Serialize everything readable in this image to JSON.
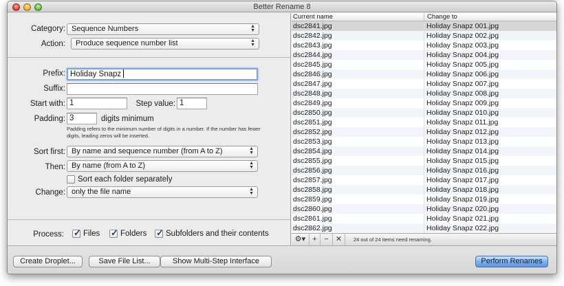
{
  "window": {
    "title": "Better Rename 8"
  },
  "form": {
    "category_label": "Category:",
    "category_value": "Sequence Numbers",
    "action_label": "Action:",
    "action_value": "Produce sequence number list",
    "prefix_label": "Prefix:",
    "prefix_value": "Holiday Snapz",
    "suffix_label": "Suffix:",
    "suffix_value": "",
    "start_label": "Start with:",
    "start_value": "1",
    "step_label": "Step value:",
    "step_value": "1",
    "padding_label": "Padding:",
    "padding_value": "3",
    "padding_suffix": "digits minimum",
    "padding_note": "Padding refers to the minimum number of digits in a number. If the number has fewer digits, leading zeros will be inserted.",
    "sort_first_label": "Sort first:",
    "sort_first_value": "By name and sequence number (from A to Z)",
    "then_label": "Then:",
    "then_value": "By name (from A to Z)",
    "sort_folder_label": "Sort each folder separately",
    "sort_folder_checked": false,
    "change_label": "Change:",
    "change_value": "only the file name",
    "process_label": "Process:",
    "process_files_label": "Files",
    "process_files_checked": true,
    "process_folders_label": "Folders",
    "process_folders_checked": true,
    "process_subfolders_label": "Subfolders and their contents",
    "process_subfolders_checked": true
  },
  "table": {
    "col_current": "Current name",
    "col_change": "Change to",
    "rows": [
      {
        "current": "dsc2841.jpg",
        "change": "Holiday Snapz 001.jpg"
      },
      {
        "current": "dsc2842.jpg",
        "change": "Holiday Snapz 002.jpg"
      },
      {
        "current": "dsc2843.jpg",
        "change": "Holiday Snapz 003.jpg"
      },
      {
        "current": "dsc2844.jpg",
        "change": "Holiday Snapz 004.jpg"
      },
      {
        "current": "dsc2845.jpg",
        "change": "Holiday Snapz 005.jpg"
      },
      {
        "current": "dsc2846.jpg",
        "change": "Holiday Snapz 006.jpg"
      },
      {
        "current": "dsc2847.jpg",
        "change": "Holiday Snapz 007.jpg"
      },
      {
        "current": "dsc2848.jpg",
        "change": "Holiday Snapz 008.jpg"
      },
      {
        "current": "dsc2849.jpg",
        "change": "Holiday Snapz 009.jpg"
      },
      {
        "current": "dsc2850.jpg",
        "change": "Holiday Snapz 010.jpg"
      },
      {
        "current": "dsc2851.jpg",
        "change": "Holiday Snapz 011.jpg"
      },
      {
        "current": "dsc2852.jpg",
        "change": "Holiday Snapz 012.jpg"
      },
      {
        "current": "dsc2853.jpg",
        "change": "Holiday Snapz 013.jpg"
      },
      {
        "current": "dsc2854.jpg",
        "change": "Holiday Snapz 014.jpg"
      },
      {
        "current": "dsc2855.jpg",
        "change": "Holiday Snapz 015.jpg"
      },
      {
        "current": "dsc2856.jpg",
        "change": "Holiday Snapz 016.jpg"
      },
      {
        "current": "dsc2857.jpg",
        "change": "Holiday Snapz 017.jpg"
      },
      {
        "current": "dsc2858.jpg",
        "change": "Holiday Snapz 018.jpg"
      },
      {
        "current": "dsc2859.jpg",
        "change": "Holiday Snapz 019.jpg"
      },
      {
        "current": "dsc2860.jpg",
        "change": "Holiday Snapz 020.jpg"
      },
      {
        "current": "dsc2861.jpg",
        "change": "Holiday Snapz 021.jpg"
      },
      {
        "current": "dsc2862.jpg",
        "change": "Holiday Snapz 022.jpg"
      }
    ],
    "status": "24 out of 24 items need renaming."
  },
  "footer_buttons": {
    "gear": "⚙▾",
    "add": "+",
    "remove": "−",
    "clear": "✕"
  },
  "buttons": {
    "create_droplet": "Create Droplet...",
    "save_file_list": "Save File List...",
    "show_multistep": "Show Multi-Step Interface",
    "perform_renames": "Perform Renames"
  }
}
